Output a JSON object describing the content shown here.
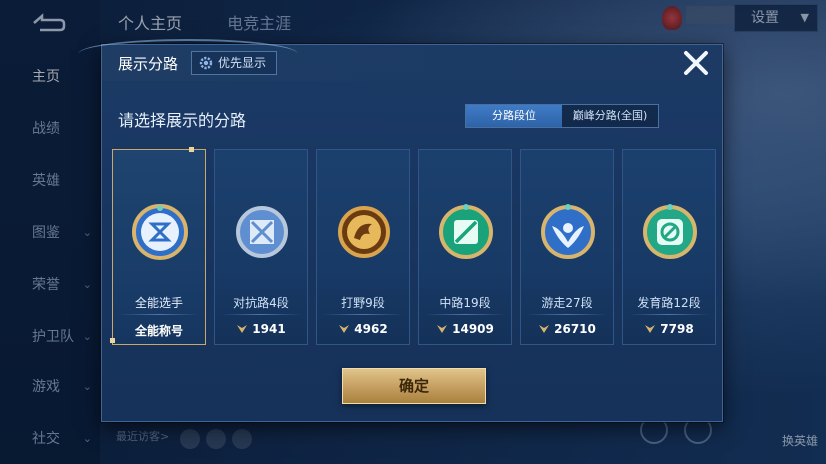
{
  "app": {
    "nav": {
      "back_icon": "back-arrow-icon",
      "items": [
        {
          "label": "主页",
          "active": true
        },
        {
          "label": "战绩"
        },
        {
          "label": "英雄"
        },
        {
          "label": "图鉴"
        },
        {
          "label": "荣誉"
        },
        {
          "label": "护卫队"
        },
        {
          "label": "游戏"
        },
        {
          "label": "社交"
        }
      ]
    },
    "top_tabs": [
      {
        "label": "个人主页",
        "active": true
      },
      {
        "label": "电竞主涯"
      }
    ],
    "settings_label": "设置",
    "bottom": {
      "recent_visitors": "最近访客>"
    },
    "right_labels": {
      "swap_hero": "换英雄"
    }
  },
  "modal": {
    "title": "展示分路",
    "priority_label": "优先显示",
    "subtitle": "请选择展示的分路",
    "segments": [
      {
        "label": "分路段位",
        "active": true
      },
      {
        "label": "巅峰分路(全国)"
      }
    ],
    "cards": [
      {
        "label": "全能选手",
        "score": "全能称号",
        "emblem": "all-rounder-emblem-icon",
        "selected": true,
        "color": "#2f6fc8"
      },
      {
        "label": "对抗路4段",
        "score": "1941",
        "emblem": "clash-lane-emblem-icon",
        "color": "#5f8fd0"
      },
      {
        "label": "打野9段",
        "score": "4962",
        "emblem": "jungle-emblem-icon",
        "color": "#c98a2c"
      },
      {
        "label": "中路19段",
        "score": "14909",
        "emblem": "mid-lane-emblem-icon",
        "color": "#1aa37a"
      },
      {
        "label": "游走27段",
        "score": "26710",
        "emblem": "roam-emblem-icon",
        "color": "#2f6fc8"
      },
      {
        "label": "发育路12段",
        "score": "7798",
        "emblem": "farm-lane-emblem-icon",
        "color": "#22a886"
      }
    ],
    "confirm_label": "确定",
    "colors": {
      "accent": "#c6a163",
      "selected_border": "#c9a86a",
      "segment_active": "#3f7bc7"
    }
  }
}
